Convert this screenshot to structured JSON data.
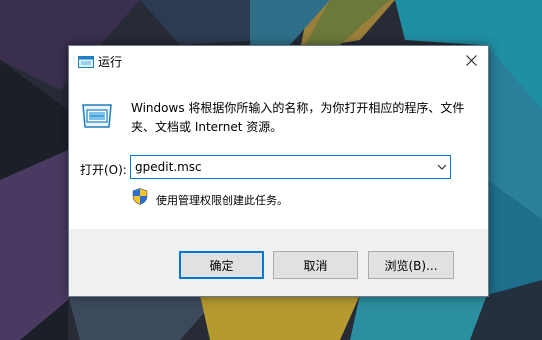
{
  "dialog": {
    "title": "运行",
    "description": "Windows 将根据你所输入的名称，为你打开相应的程序、文件夹、文档或 Internet 资源。",
    "open_label": "打开(O):",
    "open_value": "gpedit.msc",
    "admin_note": "使用管理权限创建此任务。",
    "icons": {
      "title": "run-icon",
      "close": "close-icon",
      "main": "run-icon",
      "dropdown": "chevron-down-icon",
      "shield": "uac-shield-icon"
    }
  },
  "buttons": {
    "ok": "确定",
    "cancel": "取消",
    "browse": "浏览(B)..."
  },
  "colors": {
    "focus_border": "#0078d7",
    "button_bg": "#e1e1e1",
    "footer_bg": "#f0f0f0"
  }
}
